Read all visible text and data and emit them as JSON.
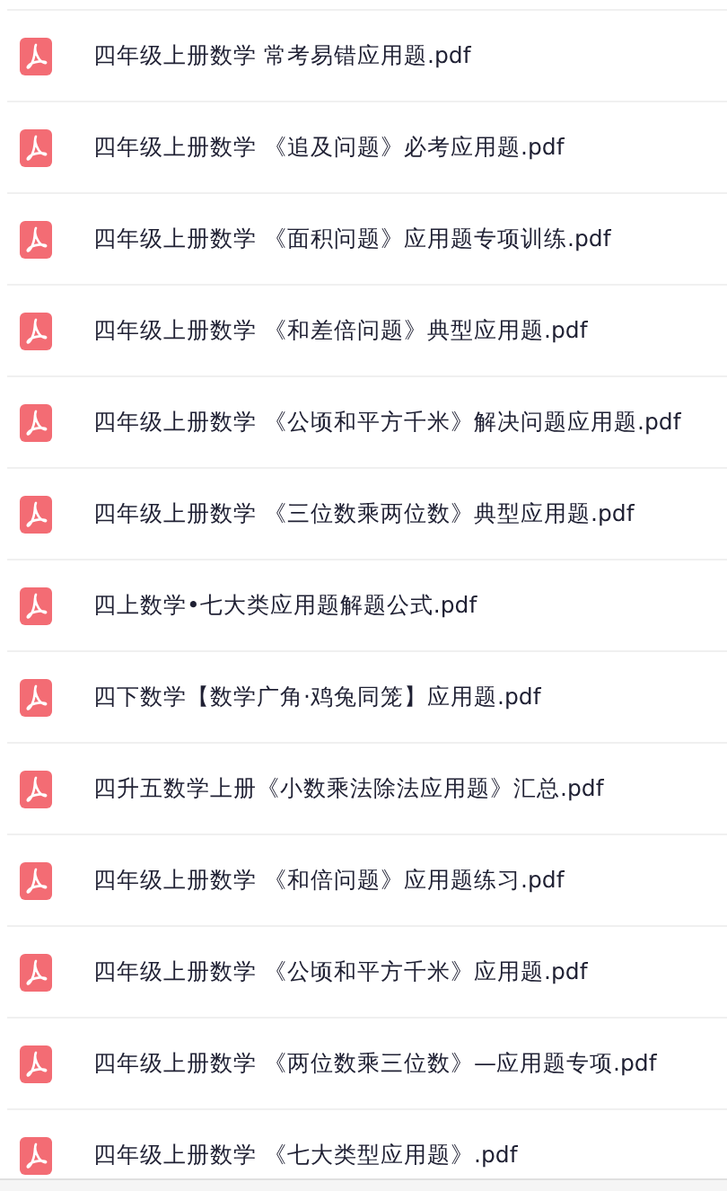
{
  "files": [
    {
      "name": "四年级上册数学 常考易错应用题.pdf"
    },
    {
      "name": "四年级上册数学 《追及问题》必考应用题.pdf"
    },
    {
      "name": "四年级上册数学 《面积问题》应用题专项训练.pdf"
    },
    {
      "name": "四年级上册数学 《和差倍问题》典型应用题.pdf"
    },
    {
      "name": "四年级上册数学 《公顷和平方千米》解决问题应用题.pdf"
    },
    {
      "name": "四年级上册数学 《三位数乘两位数》典型应用题.pdf"
    },
    {
      "name": "四上数学•七大类应用题解题公式.pdf"
    },
    {
      "name": "四下数学【数学广角·鸡兔同笼】应用题.pdf"
    },
    {
      "name": "四升五数学上册《小数乘法除法应用题》汇总.pdf"
    },
    {
      "name": "四年级上册数学 《和倍问题》应用题练习.pdf"
    },
    {
      "name": "四年级上册数学 《公顷和平方千米》应用题.pdf"
    },
    {
      "name": "四年级上册数学 《两位数乘三位数》—应用题专项.pdf"
    },
    {
      "name": "四年级上册数学 《七大类型应用题》.pdf"
    }
  ]
}
